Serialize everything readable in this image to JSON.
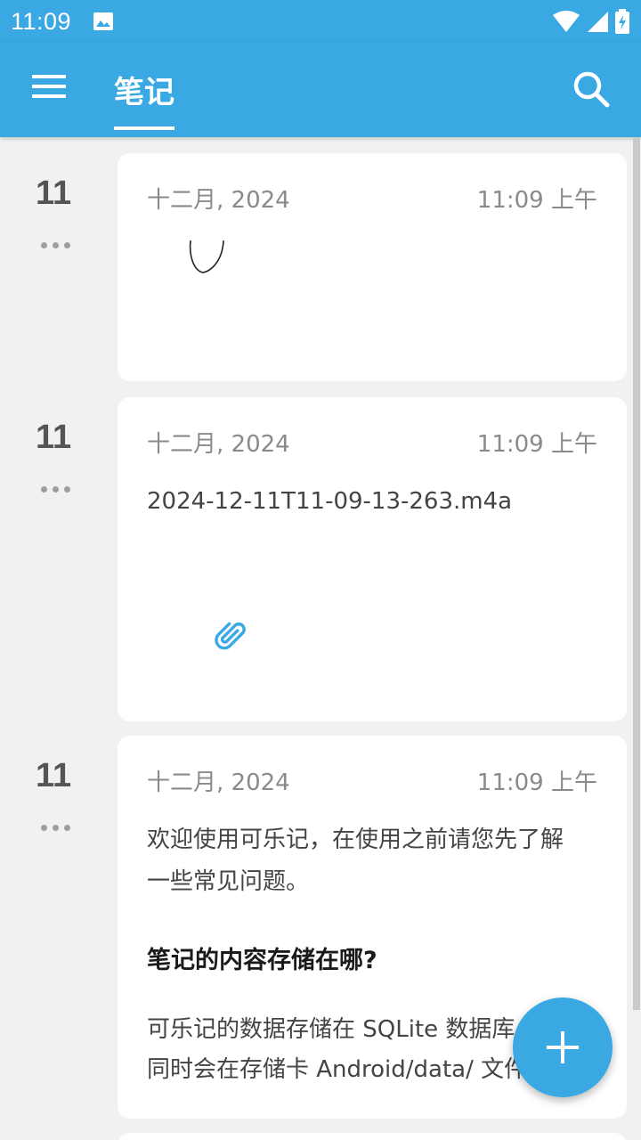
{
  "status_bar": {
    "time": "11:09",
    "icons": [
      "image-icon",
      "wifi-icon",
      "signal-icon",
      "battery-icon"
    ]
  },
  "app_bar": {
    "title": "笔记",
    "color": "#3aa8e2"
  },
  "notes": [
    {
      "day": "11",
      "date": "十二月, 2024",
      "time": "11:09 上午",
      "type": "drawing"
    },
    {
      "day": "11",
      "date": "十二月, 2024",
      "time": "11:09 上午",
      "type": "attachment",
      "filename": "2024-12-11T11-09-13-263.m4a"
    },
    {
      "day": "11",
      "date": "十二月, 2024",
      "time": "11:09 上午",
      "type": "text",
      "intro_line1": "欢迎使用可乐记，在使用之前请您先了解",
      "intro_line2": "一些常见问题。",
      "heading": "笔记的内容存储在哪?",
      "body_line1": "可乐记的数据存储在 SQLite 数据库",
      "body_line2": "同时会在存储卡 Android/data/ 文件"
    }
  ]
}
